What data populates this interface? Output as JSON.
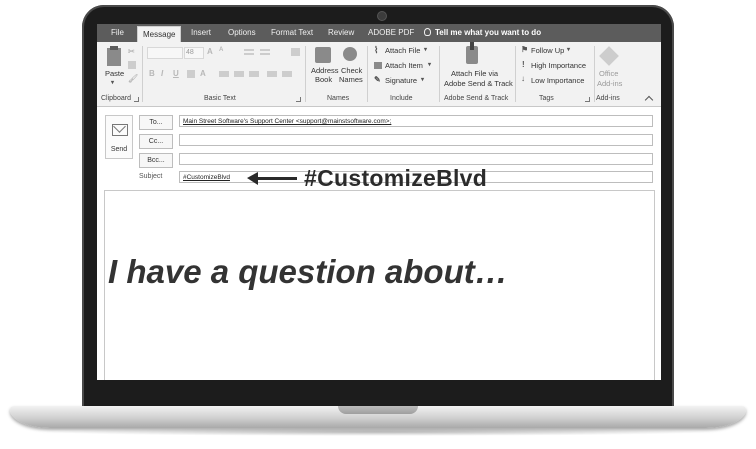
{
  "tabs": [
    {
      "label": "File"
    },
    {
      "label": "Message",
      "active": true
    },
    {
      "label": "Insert"
    },
    {
      "label": "Options"
    },
    {
      "label": "Format Text"
    },
    {
      "label": "Review"
    },
    {
      "label": "ADOBE PDF"
    }
  ],
  "tell_me": "Tell me what you want to do",
  "ribbon": {
    "clipboard": {
      "paste": "Paste",
      "group": "Clipboard"
    },
    "basic_text": {
      "font_size": "48",
      "bold": "B",
      "italic": "I",
      "underline": "U",
      "grow": "A",
      "shrink": "A",
      "group": "Basic Text"
    },
    "names": {
      "address_book_1": "Address",
      "address_book_2": "Book",
      "check_names_1": "Check",
      "check_names_2": "Names",
      "group": "Names"
    },
    "include": {
      "attach_file": "Attach File",
      "attach_item": "Attach Item",
      "signature": "Signature",
      "group": "Include"
    },
    "adobe": {
      "line1": "Attach File via",
      "line2": "Adobe Send & Track",
      "group": "Adobe Send & Track"
    },
    "tags": {
      "follow_up": "Follow Up",
      "high": "High Importance",
      "low": "Low Importance",
      "group": "Tags"
    },
    "addins": {
      "line1": "Office",
      "line2": "Add-ins",
      "group": "Add-ins"
    }
  },
  "compose": {
    "send": "Send",
    "to_button": "To...",
    "cc_button": "Cc...",
    "bcc_button": "Bcc...",
    "to_value": "Main Street Software's Support Center <support@mainstsoftware.com>;",
    "cc_value": "",
    "bcc_value": "",
    "subject_label": "Subject",
    "subject_value": "#CustomizeBlvd",
    "callout": "#CustomizeBlvd",
    "body": "I have a question about…"
  },
  "colors": {
    "frame": "#1c1c1c",
    "tab_bar": "#5c5c5c",
    "ribbon": "#f2f2f2"
  }
}
